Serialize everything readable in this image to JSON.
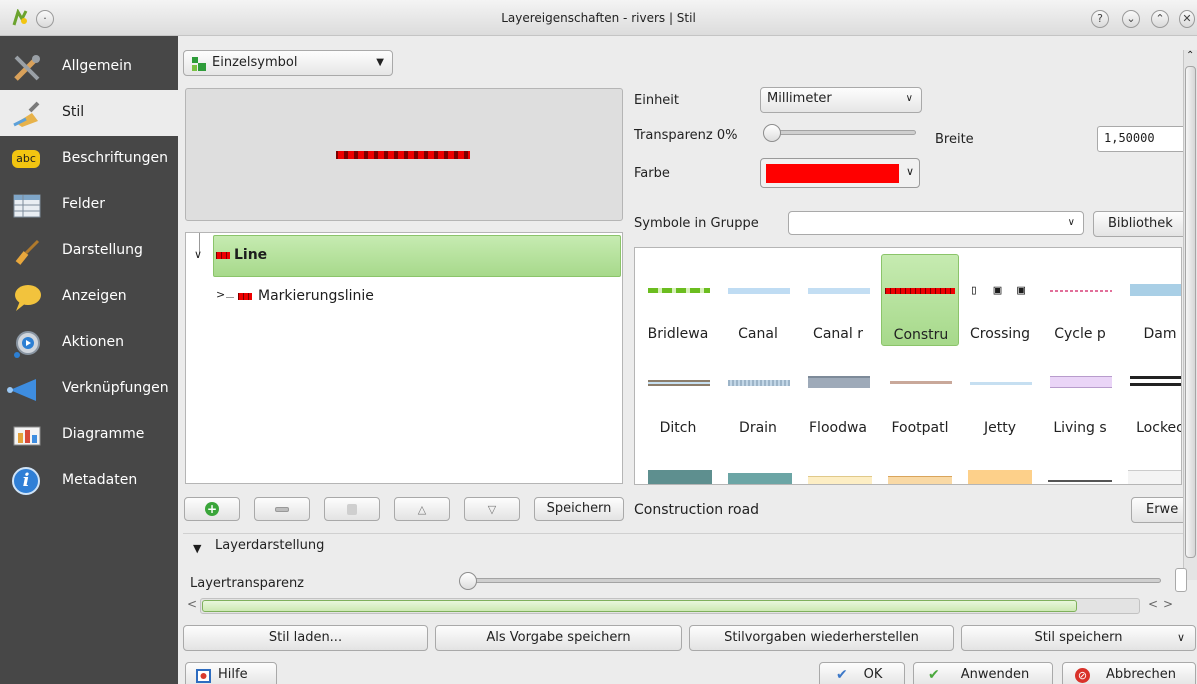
{
  "window": {
    "title": "Layereigenschaften - rivers | Stil"
  },
  "colors": {
    "sidebar_bg": "#474747",
    "selection": "#a7d98b",
    "farbe": "#ff0000"
  },
  "sidebar": {
    "items": [
      {
        "label": "Allgemein",
        "icon": "tools-icon"
      },
      {
        "label": "Stil",
        "icon": "brush-icon"
      },
      {
        "label": "Beschriftungen",
        "icon": "abc-label-icon",
        "icon_text": "abc"
      },
      {
        "label": "Felder",
        "icon": "table-icon"
      },
      {
        "label": "Darstellung",
        "icon": "paintbrush-icon"
      },
      {
        "label": "Anzeigen",
        "icon": "speech-bubble-icon"
      },
      {
        "label": "Aktionen",
        "icon": "gear-play-icon"
      },
      {
        "label": "Verknüpfungen",
        "icon": "join-arrow-icon"
      },
      {
        "label": "Diagramme",
        "icon": "chart-icon"
      },
      {
        "label": "Metadaten",
        "icon": "info-icon",
        "icon_text": "i"
      }
    ]
  },
  "renderer": {
    "selected": "Einzelsymbol"
  },
  "tree": {
    "root": "Line",
    "child": "Markierungslinie"
  },
  "props": {
    "einheit_label": "Einheit",
    "einheit_value": "Millimeter",
    "transparenz_label": "Transparenz 0%",
    "breite_label": "Breite",
    "breite_value": "1,50000",
    "farbe_label": "Farbe"
  },
  "symbols": {
    "group_label": "Symbole in Gruppe",
    "group_value": "",
    "library_button": "Bibliothek",
    "items": [
      {
        "name": "Bridlewa"
      },
      {
        "name": "Canal"
      },
      {
        "name": "Canal r"
      },
      {
        "name": "Constru"
      },
      {
        "name": "Crossing"
      },
      {
        "name": "Cycle p"
      },
      {
        "name": "Dam"
      },
      {
        "name": "Ditch"
      },
      {
        "name": "Drain"
      },
      {
        "name": "Floodwa"
      },
      {
        "name": "Footpatl"
      },
      {
        "name": "Jetty"
      },
      {
        "name": "Living s"
      },
      {
        "name": "Lockec"
      }
    ],
    "selected_name": "Construction road",
    "advanced_button": "Erwe"
  },
  "tree_buttons": {
    "save": "Speichern"
  },
  "layer_rendering": {
    "section_title": "Layerdarstellung",
    "transparency_label": "Layertransparenz"
  },
  "style_buttons": {
    "load": "Stil laden...",
    "save_default": "Als Vorgabe speichern",
    "restore_default": "Stilvorgaben wiederherstellen",
    "save_style": "Stil speichern"
  },
  "bottom": {
    "help": "Hilfe",
    "ok": "OK",
    "apply": "Anwenden",
    "cancel": "Abbrechen"
  }
}
